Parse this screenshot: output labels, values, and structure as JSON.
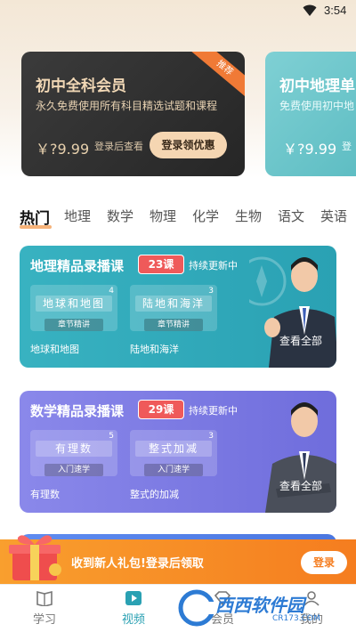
{
  "status_bar": {
    "time": "3:54"
  },
  "membership_cards": [
    {
      "title": "初中全科会员",
      "subtitle": "永久免费使用所有科目精选试题和课程",
      "price": "￥?9.99",
      "price_note": "登录后查看",
      "cta": "登录领优惠",
      "ribbon": "推荐"
    },
    {
      "title": "初中地理单",
      "subtitle": "免费使用初中地",
      "price": "￥?9.99",
      "price_note": "登"
    }
  ],
  "subject_tabs": [
    "热门",
    "地理",
    "数学",
    "物理",
    "化学",
    "生物",
    "语文",
    "英语"
  ],
  "active_tab": "热门",
  "courses": [
    {
      "title": "地理精品录播课",
      "count": "23课",
      "status": "持续更新中",
      "chapters": [
        {
          "board": "地球和地图",
          "num": "4",
          "tag": "章节精讲",
          "label": "地球和地图"
        },
        {
          "board": "陆地和海洋",
          "num": "3",
          "tag": "章节精讲",
          "label": "陆地和海洋"
        }
      ],
      "see_all": "查看全部",
      "color": "#2aa1b3"
    },
    {
      "title": "数学精品录播课",
      "count": "29课",
      "status": "持续更新中",
      "chapters": [
        {
          "board": "有理数",
          "num": "5",
          "tag": "入门速学",
          "label": "有理数"
        },
        {
          "board": "整式加减",
          "num": "3",
          "tag": "入门速学",
          "label": "整式的加减"
        }
      ],
      "see_all": "查看全部",
      "color": "#6f6ddc"
    }
  ],
  "promo": {
    "text": "收到新人礼包!登录后领取",
    "button": "登录"
  },
  "bottom_nav": [
    {
      "label": "学习",
      "icon": "book-icon",
      "active": false
    },
    {
      "label": "视频",
      "icon": "play-icon",
      "active": true
    },
    {
      "label": "会员",
      "icon": "member-icon",
      "active": false
    },
    {
      "label": "我的",
      "icon": "profile-icon",
      "active": false
    }
  ],
  "watermark": {
    "text": "西西软件园",
    "url": "CR173.COM"
  },
  "colors": {
    "accent": "#2aa1b3",
    "promo": "#f57d1f",
    "gold": "#f5d6b2"
  }
}
